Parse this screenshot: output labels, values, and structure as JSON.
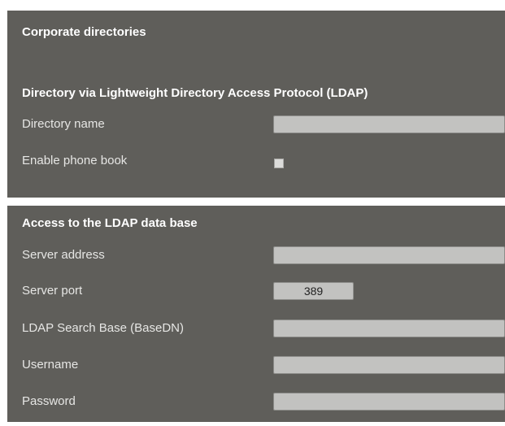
{
  "corporate": {
    "title": "Corporate directories",
    "subtitle": "Directory via Lightweight Directory Access Protocol (LDAP)",
    "fields": {
      "directory_name_label": "Directory name",
      "directory_name_value": "",
      "enable_phonebook_label": "Enable phone book",
      "enable_phonebook_checked": false
    }
  },
  "ldap_access": {
    "title": "Access to the LDAP data base",
    "server_address_label": "Server address",
    "server_address_value": "",
    "server_port_label": "Server port",
    "server_port_value": "389",
    "search_base_label": "LDAP Search Base (BaseDN)",
    "search_base_value": "",
    "username_label": "Username",
    "username_value": "",
    "password_label": "Password",
    "password_value": ""
  }
}
